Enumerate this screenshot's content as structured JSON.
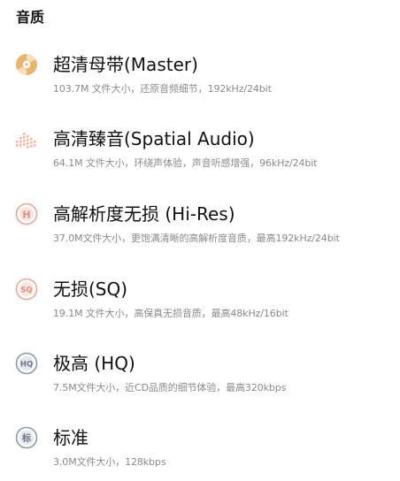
{
  "header": {
    "title": "音质"
  },
  "options": [
    {
      "title": "超清母带(Master)",
      "desc": "103.7M 文件大小，还原音频细节，192kHz/24bit",
      "icon": "master-disc-icon",
      "icon_color": "#E7B56B"
    },
    {
      "title": "高清臻音(Spatial Audio)",
      "desc": "64.1M 文件大小，环绕声体验，声音听感增强，96kHz/24bit",
      "icon": "spatial-audio-icon",
      "icon_color": "#F0B49B"
    },
    {
      "title": "高解析度无损 (Hi-Res)",
      "desc": "37.0M文件大小，更饱满清晰的高解析度音质，最高192kHz/24bit",
      "icon": "hi-res-icon",
      "icon_badge": "H",
      "icon_color": "#E6A59A"
    },
    {
      "title": "无损(SQ)",
      "desc": "19.1M 文件大小，高保真无损音质，最高48kHz/16bit",
      "icon": "sq-icon",
      "icon_badge": "SQ",
      "icon_color": "#E9A79B"
    },
    {
      "title": "极高 (HQ)",
      "desc": "7.5M文件大小，近CD品质的细节体验，最高320kbps",
      "icon": "hq-icon",
      "icon_badge": "HQ",
      "icon_color": "#8E96A8"
    },
    {
      "title": "标准",
      "desc": "3.0M文件大小，128kbps",
      "icon": "standard-icon",
      "icon_badge": "标",
      "icon_color": "#8E96A8"
    }
  ]
}
